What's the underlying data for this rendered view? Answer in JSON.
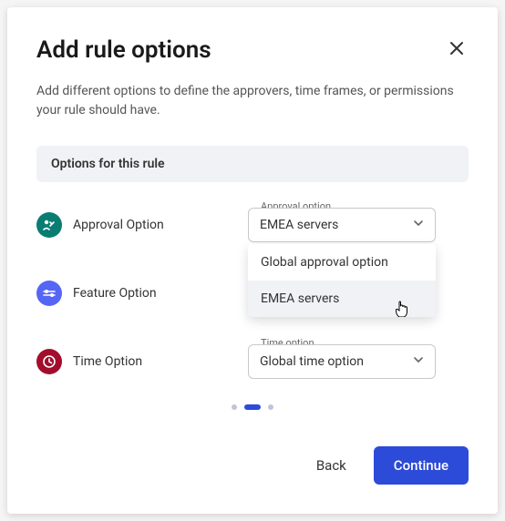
{
  "title": "Add rule options",
  "description": "Add different options to define the approvers, time frames, or permissions your rule should have.",
  "banner": "Options for this rule",
  "options": {
    "approval": {
      "label": "Approval Option",
      "legend": "Approval option",
      "value": "EMEA servers",
      "menu": {
        "item0": "Global approval option",
        "item1": "EMEA servers"
      }
    },
    "feature": {
      "label": "Feature Option"
    },
    "time": {
      "label": "Time Option",
      "legend": "Time option",
      "value": "Global time option"
    }
  },
  "footer": {
    "back": "Back",
    "continue": "Continue"
  }
}
